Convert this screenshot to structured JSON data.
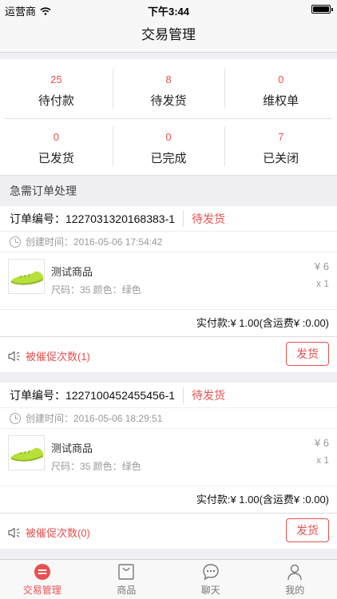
{
  "status_bar": {
    "carrier": "运营商",
    "time": "下午3:44"
  },
  "nav": {
    "title": "交易管理"
  },
  "stats": {
    "row1": [
      {
        "count": "25",
        "label": "待付款"
      },
      {
        "count": "8",
        "label": "待发货"
      },
      {
        "count": "0",
        "label": "维权单"
      }
    ],
    "row2": [
      {
        "count": "0",
        "label": "已发货"
      },
      {
        "count": "0",
        "label": "已完成"
      },
      {
        "count": "7",
        "label": "已关闭"
      }
    ]
  },
  "section": {
    "title": "急需订单处理"
  },
  "orders": [
    {
      "number_label": "订单编号：",
      "number": "1227031320168383-1",
      "status": "待发货",
      "created": "创建时间：2016-05-06 17:54:42",
      "product_name": "测试商品",
      "spec": "尺码：35 颜色：绿色",
      "price": "¥ 6",
      "qty": "x 1",
      "paid": "实付款:¥ 1.00(含运费¥ :0.00)",
      "remind": "被催促次数(1)",
      "action": "发货"
    },
    {
      "number_label": "订单编号：",
      "number": "1227100452455456-1",
      "status": "待发货",
      "created": "创建时间：2016-05-06 18:29:51",
      "product_name": "测试商品",
      "spec": "尺码：35 颜色：绿色",
      "price": "¥ 6",
      "qty": "x 1",
      "paid": "实付款:¥ 1.00(含运费¥ :0.00)",
      "remind": "被催促次数(0)",
      "action": "发货"
    }
  ],
  "tabs": [
    {
      "label": "交易管理",
      "icon": "trade-icon",
      "active": true
    },
    {
      "label": "商品",
      "icon": "bag-icon",
      "active": false
    },
    {
      "label": "聊天",
      "icon": "chat-icon",
      "active": false
    },
    {
      "label": "我的",
      "icon": "user-icon",
      "active": false
    }
  ],
  "colors": {
    "accent": "#e8504f",
    "background": "#efeff4"
  }
}
